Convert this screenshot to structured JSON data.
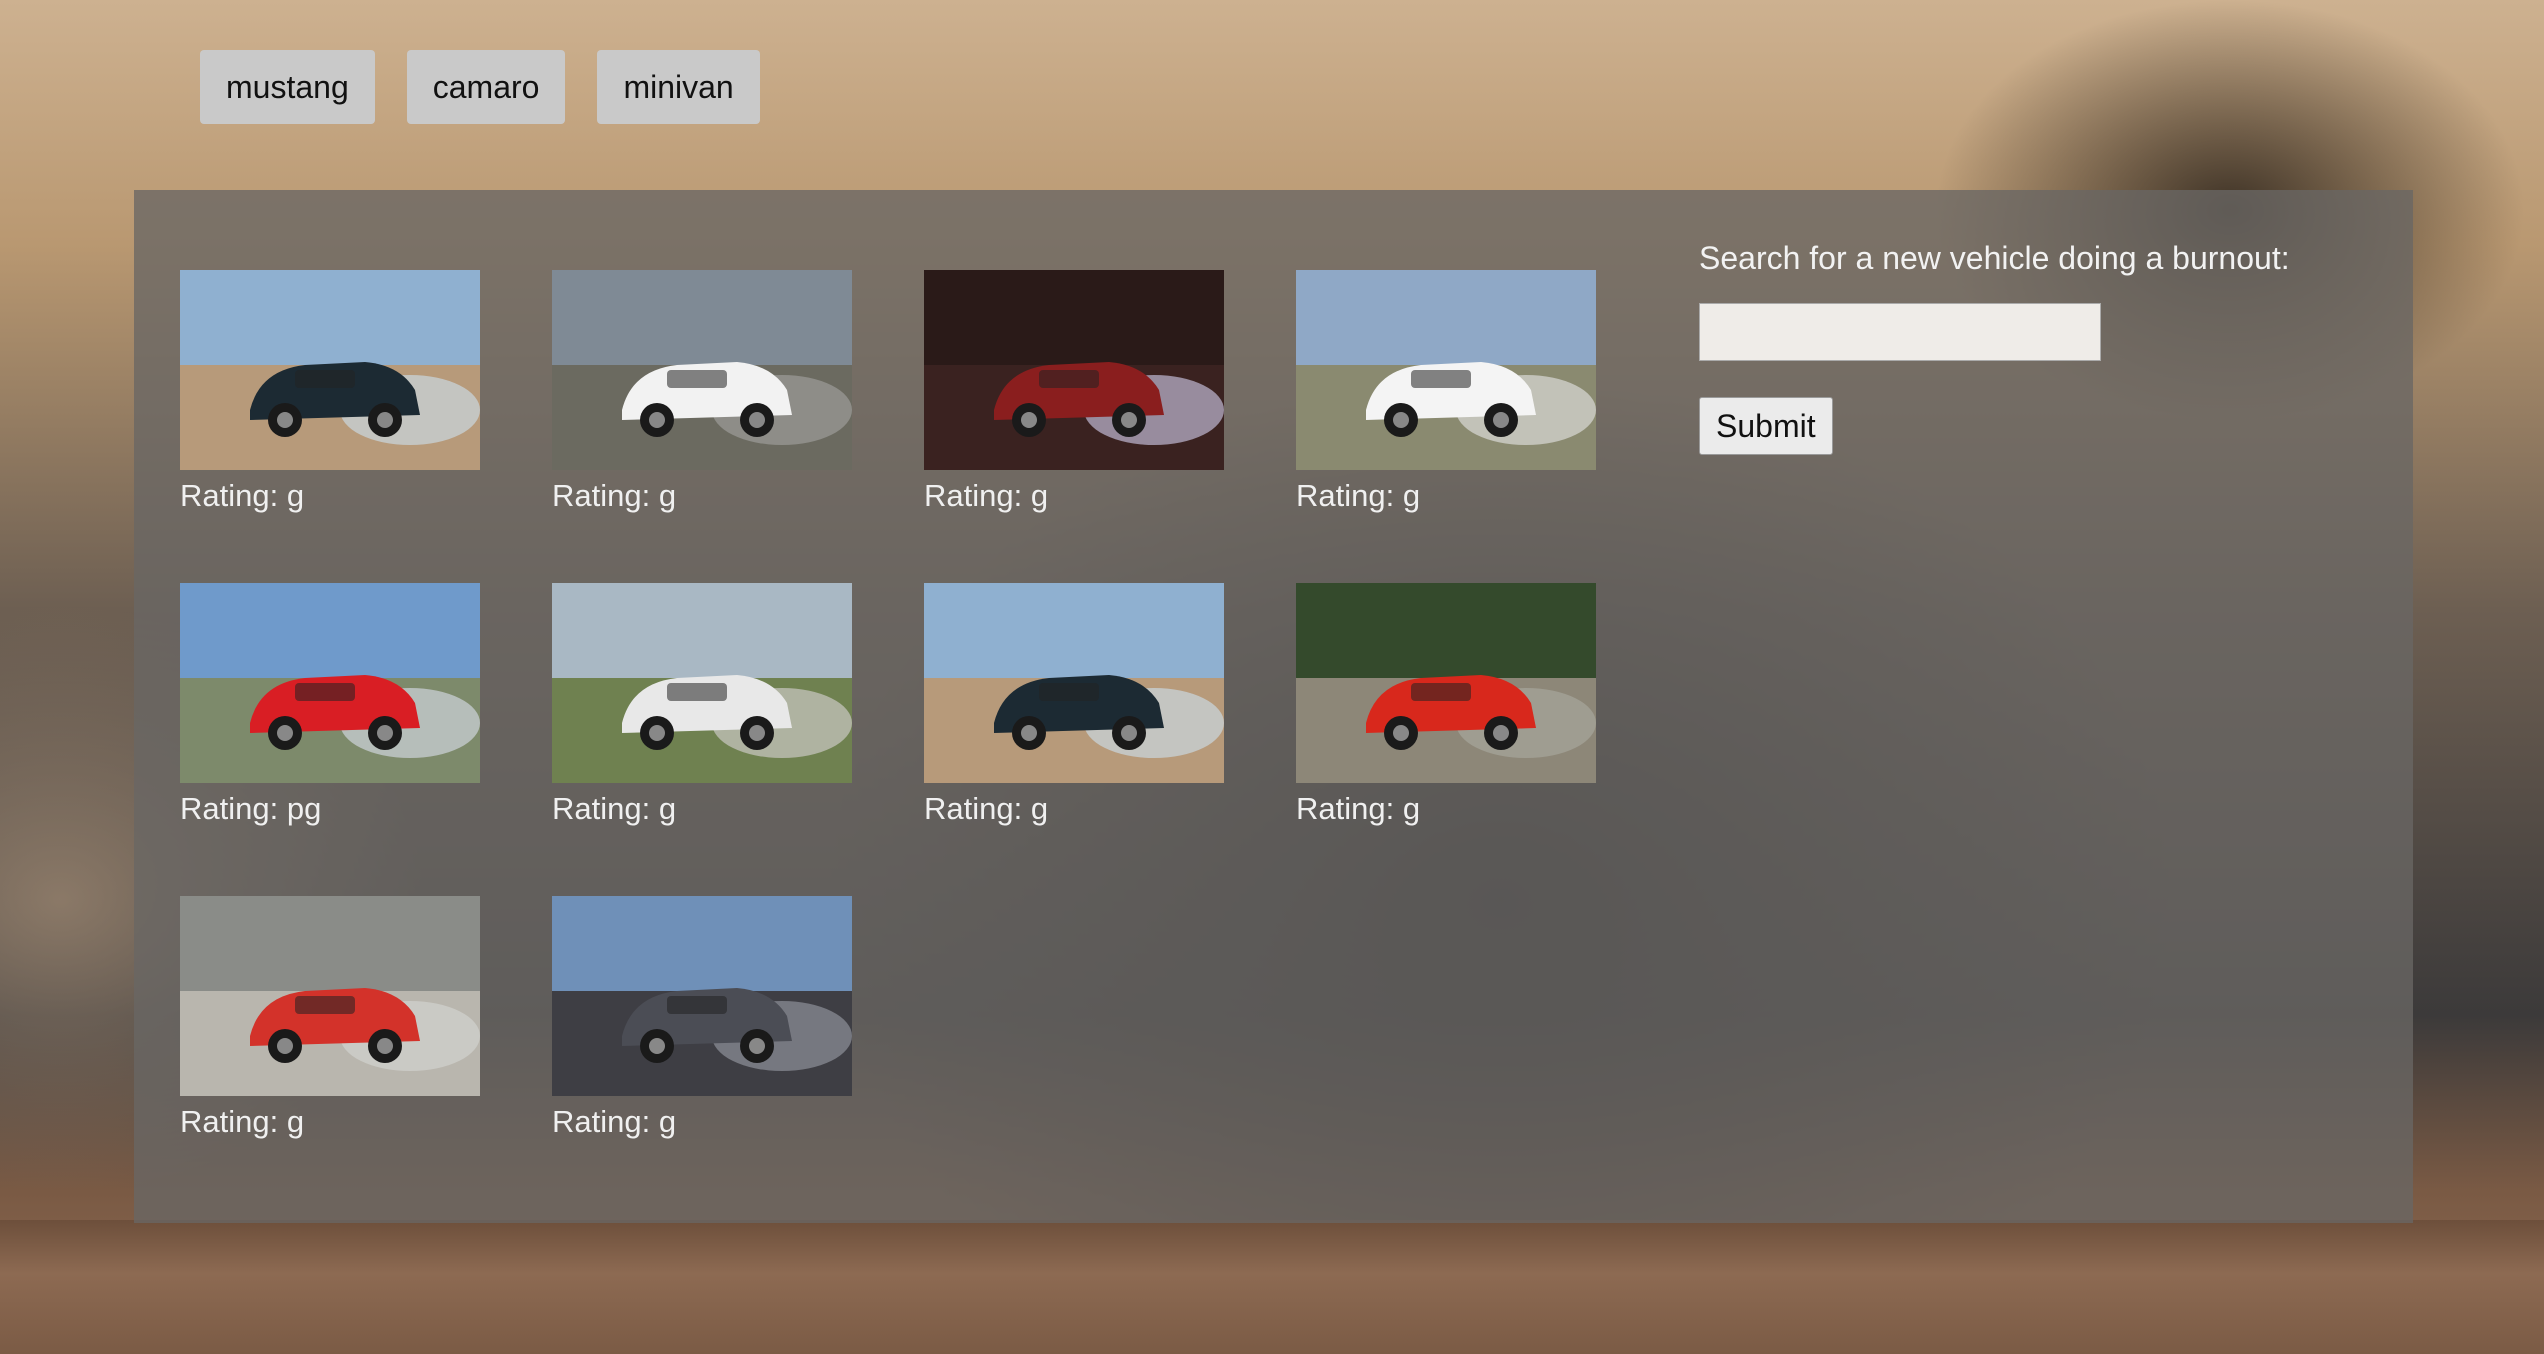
{
  "tags": [
    {
      "label": "mustang"
    },
    {
      "label": "camaro"
    },
    {
      "label": "minivan"
    }
  ],
  "gallery": {
    "items": [
      {
        "rating": "Rating: g",
        "scene": {
          "sky": "#8fb0d0",
          "ground": "#b79a7a",
          "car": "#1c2a33",
          "smoke": "#c8d3da"
        }
      },
      {
        "rating": "Rating: g",
        "scene": {
          "sky": "#7f8a95",
          "ground": "#6b6a60",
          "car": "#f2f2f2",
          "smoke": "#9a9a95"
        }
      },
      {
        "rating": "Rating: g",
        "scene": {
          "sky": "#2a1a18",
          "ground": "#3a2220",
          "car": "#8a1e1e",
          "smoke": "#b8b0c8"
        }
      },
      {
        "rating": "Rating: g",
        "scene": {
          "sky": "#8fa8c6",
          "ground": "#8a8a70",
          "car": "#f4f4f4",
          "smoke": "#d4d4d0"
        }
      },
      {
        "rating": "Rating: pg",
        "scene": {
          "sky": "#6f9acb",
          "ground": "#7d8a6b",
          "car": "#d91e24",
          "smoke": "#c9cfd4"
        }
      },
      {
        "rating": "Rating: g",
        "scene": {
          "sky": "#a9b8c4",
          "ground": "#6f8150",
          "car": "#e8e8e8",
          "smoke": "#c4c4bc"
        }
      },
      {
        "rating": "Rating: g",
        "scene": {
          "sky": "#8fb0d0",
          "ground": "#b79a7a",
          "car": "#1c2a33",
          "smoke": "#c8d3da"
        }
      },
      {
        "rating": "Rating: g",
        "scene": {
          "sky": "#344a2c",
          "ground": "#8d8778",
          "car": "#d8281c",
          "smoke": "#a6a49a"
        }
      },
      {
        "rating": "Rating: g",
        "scene": {
          "sky": "#8a8c88",
          "ground": "#b9b6ae",
          "car": "#d3322a",
          "smoke": "#d0d0cc"
        }
      },
      {
        "rating": "Rating: g",
        "scene": {
          "sky": "#6f90b8",
          "ground": "#3e3e44",
          "car": "#4b4d55",
          "smoke": "#8a8c94"
        }
      }
    ]
  },
  "search": {
    "label": "Search for a new vehicle doing a burnout:",
    "input_value": "",
    "submit_label": "Submit"
  }
}
